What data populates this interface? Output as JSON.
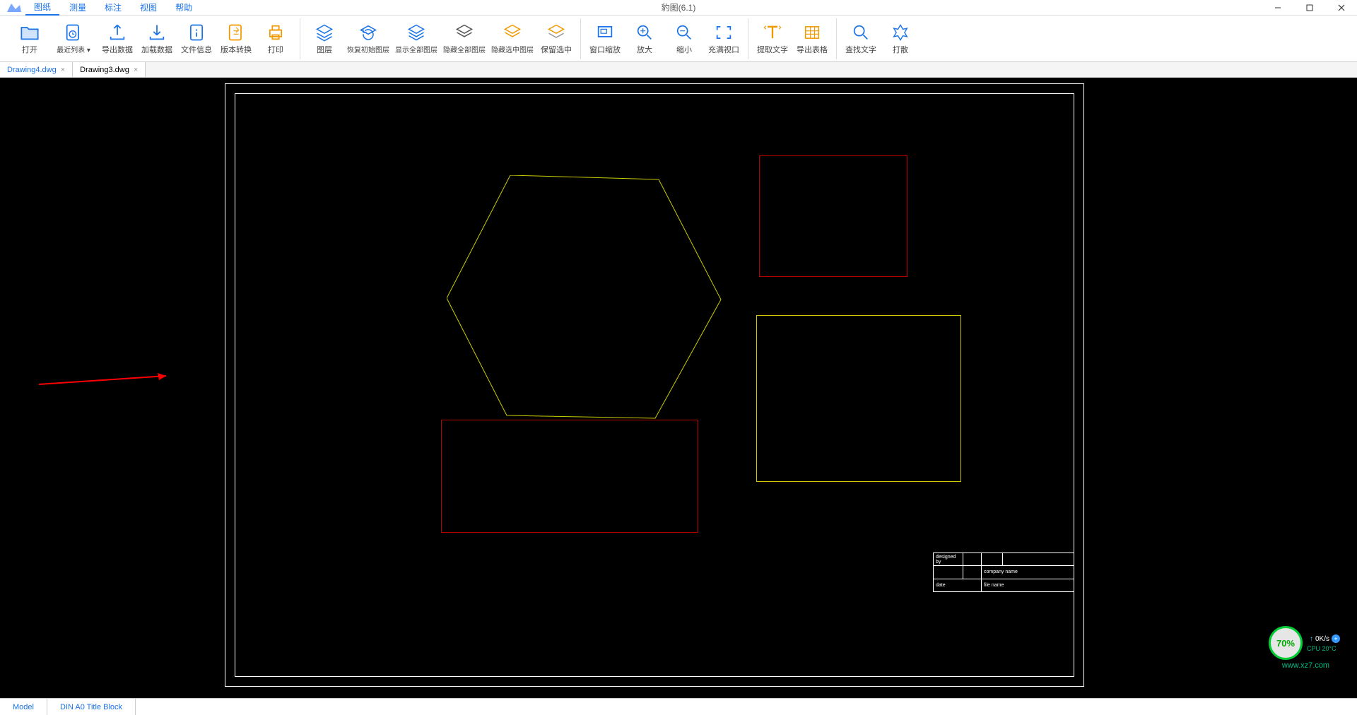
{
  "app": {
    "title": "豹图(6.1)"
  },
  "menu": {
    "items": [
      "图纸",
      "测量",
      "标注",
      "视图",
      "帮助"
    ],
    "active": 0
  },
  "toolbar": {
    "groups": [
      [
        {
          "label": "打开",
          "icon": "open"
        },
        {
          "label": "最近列表 ▾",
          "icon": "recent"
        },
        {
          "label": "导出数据",
          "icon": "export"
        },
        {
          "label": "加载数据",
          "icon": "import"
        },
        {
          "label": "文件信息",
          "icon": "fileinfo"
        },
        {
          "label": "版本转换",
          "icon": "convert",
          "orange": true
        },
        {
          "label": "打印",
          "icon": "print",
          "orange": true
        }
      ],
      [
        {
          "label": "图层",
          "icon": "layers"
        },
        {
          "label": "恢复初始图层",
          "icon": "reset-layer"
        },
        {
          "label": "显示全部图层",
          "icon": "show-all",
          "wide": true
        },
        {
          "label": "隐藏全部图层",
          "icon": "hide-all",
          "wide": true
        },
        {
          "label": "隐藏选中图层",
          "icon": "hide-sel",
          "orange": true,
          "wide": true
        },
        {
          "label": "保留选中",
          "icon": "keep-sel",
          "orange": true
        }
      ],
      [
        {
          "label": "窗口缩放",
          "icon": "zoom-window"
        },
        {
          "label": "放大",
          "icon": "zoom-in"
        },
        {
          "label": "缩小",
          "icon": "zoom-out"
        },
        {
          "label": "充满视口",
          "icon": "fit"
        }
      ],
      [
        {
          "label": "提取文字",
          "icon": "extract-text",
          "orange": true
        },
        {
          "label": "导出表格",
          "icon": "export-table",
          "orange": true
        }
      ],
      [
        {
          "label": "查找文字",
          "icon": "find"
        },
        {
          "label": "打散",
          "icon": "explode"
        }
      ]
    ]
  },
  "tabs": [
    {
      "name": "Drawing4.dwg",
      "active": true
    },
    {
      "name": "Drawing3.dwg",
      "active": false
    }
  ],
  "bottom_tabs": [
    "Model",
    "DIN A0 Title Block"
  ],
  "titleblock": {
    "r1c1": "designed by",
    "r1c2": "",
    "r1c3": "",
    "r1c4": "",
    "r2c3": "company name",
    "r3c1": "date",
    "r3c2": "file name"
  },
  "watermark": {
    "percent": "70%",
    "speed": "0K/s",
    "cpu": "CPU 20°C",
    "url": "www.xz7.com"
  }
}
